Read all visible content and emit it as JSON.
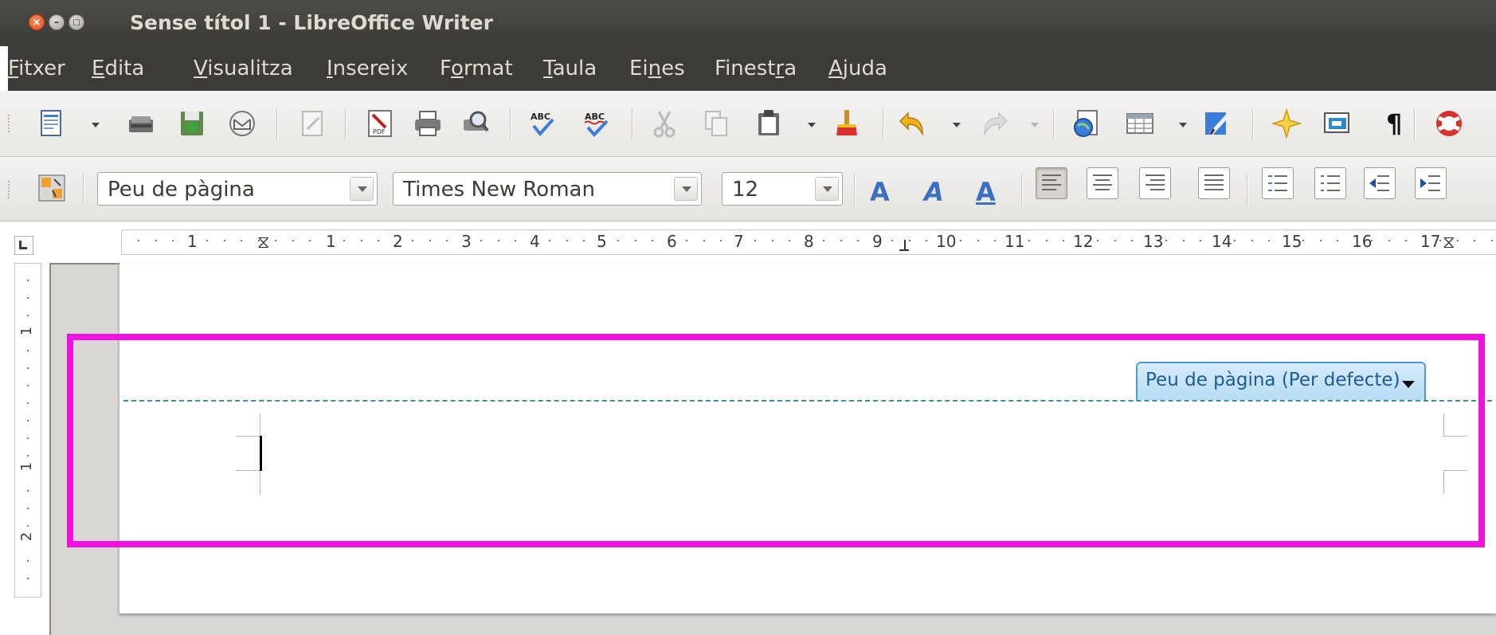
{
  "window": {
    "title": "Sense títol 1 - LibreOffice Writer",
    "controls": [
      "close",
      "minimize",
      "maximize"
    ]
  },
  "menu": {
    "items": [
      {
        "pre": "",
        "ul": "F",
        "post": "itxer"
      },
      {
        "pre": "",
        "ul": "E",
        "post": "dita"
      },
      {
        "pre": "",
        "ul": "V",
        "post": "isualitza"
      },
      {
        "pre": "",
        "ul": "I",
        "post": "nsereix"
      },
      {
        "pre": "F",
        "ul": "o",
        "post": "rmat"
      },
      {
        "pre": "",
        "ul": "T",
        "post": "aula"
      },
      {
        "pre": "Ei",
        "ul": "n",
        "post": "es"
      },
      {
        "pre": "Finest",
        "ul": "r",
        "post": "a"
      },
      {
        "pre": "",
        "ul": "A",
        "post": "juda"
      }
    ]
  },
  "standard_toolbar": {
    "icons": [
      "new-document-icon",
      "open-icon",
      "save-icon",
      "email-icon",
      "edit-mode-icon",
      "export-pdf-icon",
      "print-icon",
      "print-preview-icon",
      "spellcheck-icon",
      "autospellcheck-icon",
      "cut-icon",
      "copy-icon",
      "paste-icon",
      "clone-formatting-icon",
      "undo-icon",
      "redo-icon",
      "navigator-icon",
      "table-icon",
      "draw-functions-icon",
      "gallery-icon",
      "data-sources-icon",
      "formatting-marks-icon",
      "help-icon"
    ],
    "formatting_marks_glyph": "¶"
  },
  "formatting_toolbar": {
    "paragraph_style": "Peu de pàgina",
    "font_name": "Times New Roman",
    "font_size": "12",
    "bold_glyph": "A",
    "italic_glyph": "A",
    "underline_glyph": "A",
    "alignment_active": "left"
  },
  "ruler": {
    "horizontal_labels": [
      "1",
      "1",
      "2",
      "3",
      "4",
      "5",
      "6",
      "7",
      "8",
      "9",
      "10",
      "11",
      "12",
      "13",
      "14",
      "15",
      "16",
      "17"
    ],
    "vertical_labels": [
      "1",
      "1",
      "2"
    ]
  },
  "document": {
    "footer_label": "Peu de pàgina (Per defecte)",
    "highlight_color": "#ee11e0",
    "footer_tab_color": "#b7dcf5"
  }
}
